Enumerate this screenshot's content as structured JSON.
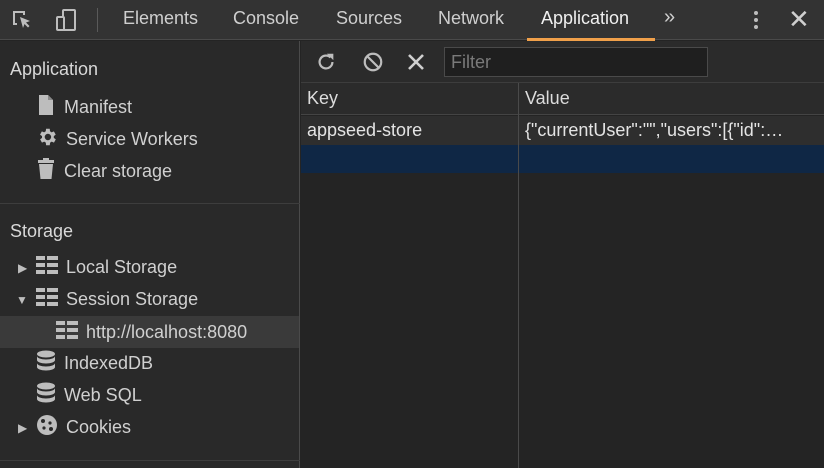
{
  "tabs": [
    {
      "label": "Elements"
    },
    {
      "label": "Console"
    },
    {
      "label": "Sources"
    },
    {
      "label": "Network"
    },
    {
      "label": "Application",
      "active": true
    }
  ],
  "overflow_tabs": "»",
  "close": "✕",
  "accent_color": "#f0a04a",
  "sidebar": {
    "application": {
      "title": "Application",
      "items": [
        {
          "label": "Manifest",
          "icon": "file-icon"
        },
        {
          "label": "Service Workers",
          "icon": "gear-icon"
        },
        {
          "label": "Clear storage",
          "icon": "trash-icon"
        }
      ]
    },
    "storage": {
      "title": "Storage",
      "items": [
        {
          "label": "Local Storage",
          "icon": "grid-icon",
          "expanded": false
        },
        {
          "label": "Session Storage",
          "icon": "grid-icon",
          "expanded": true
        },
        {
          "label": "http://localhost:8080",
          "icon": "grid-icon",
          "selected": true
        },
        {
          "label": "IndexedDB",
          "icon": "database-icon"
        },
        {
          "label": "Web SQL",
          "icon": "database-icon"
        },
        {
          "label": "Cookies",
          "icon": "cookie-icon",
          "expanded": false
        }
      ]
    }
  },
  "toolbar": {
    "filter_placeholder": "Filter"
  },
  "table": {
    "headers": [
      "Key",
      "Value"
    ],
    "rows": [
      {
        "key": "appseed-store",
        "value": "{\"currentUser\":\"\",\"users\":[{\"id\":…"
      }
    ],
    "selected_row_color": "#0f2745"
  }
}
